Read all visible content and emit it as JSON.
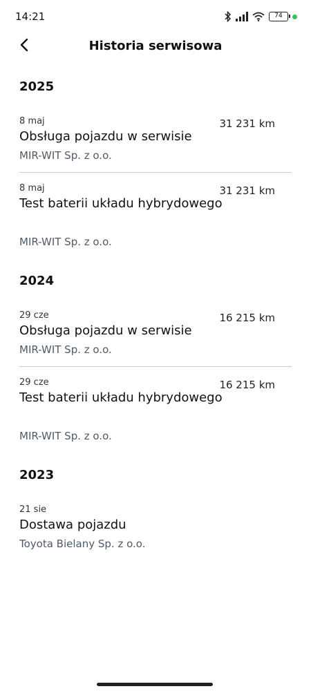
{
  "status_bar": {
    "time": "14:21",
    "battery": "74",
    "icons": [
      "bluetooth-icon",
      "signal-icon",
      "wifi-icon",
      "battery-icon"
    ],
    "dot_color": "#3cc25b"
  },
  "header": {
    "title": "Historia serwisowa",
    "back_icon": "chevron-left-icon"
  },
  "sections": [
    {
      "year": "2025",
      "entries": [
        {
          "date": "8 maj",
          "km": "31 231 km",
          "title": "Obsługa pojazdu w serwisie",
          "dealer": "MIR-WIT Sp. z o.o."
        },
        {
          "date": "8 maj",
          "km": "31 231 km",
          "title": "Test baterii układu hybrydowego",
          "dealer": "MIR-WIT Sp. z o.o."
        }
      ]
    },
    {
      "year": "2024",
      "entries": [
        {
          "date": "29 cze",
          "km": "16 215 km",
          "title": "Obsługa pojazdu w serwisie",
          "dealer": "MIR-WIT Sp. z o.o."
        },
        {
          "date": "29 cze",
          "km": "16 215 km",
          "title": "Test baterii układu hybrydowego",
          "dealer": "MIR-WIT Sp. z o.o."
        }
      ]
    },
    {
      "year": "2023",
      "entries": [
        {
          "date": "21 sie",
          "km": "",
          "title": "Dostawa pojazdu",
          "dealer": "Toyota Bielany Sp. z o.o."
        }
      ]
    }
  ]
}
